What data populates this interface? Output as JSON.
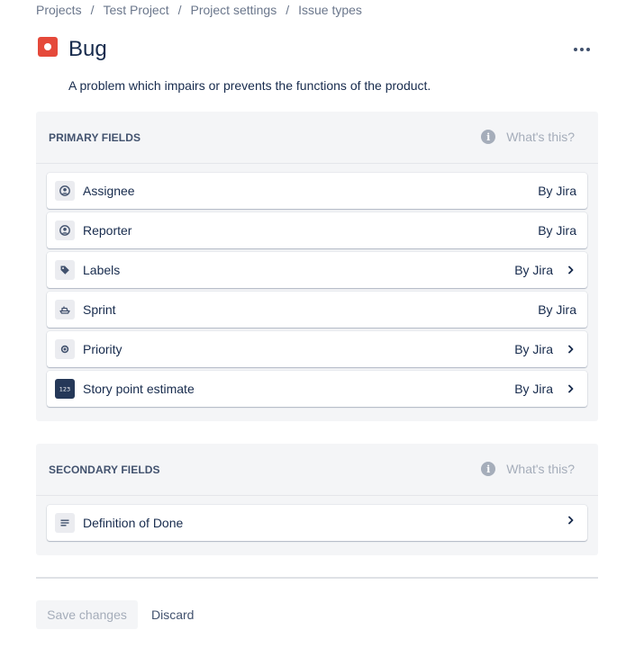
{
  "breadcrumb": {
    "items": [
      "Projects",
      "Test Project",
      "Project settings",
      "Issue types"
    ],
    "separator": "/"
  },
  "issue_type": {
    "title": "Bug",
    "icon": "bug-icon",
    "icon_color": "#e5493a",
    "description": "A problem which impairs or prevents the functions of the product."
  },
  "primary": {
    "title": "PRIMARY FIELDS",
    "help_label": "What's this?",
    "fields": [
      {
        "label": "Assignee",
        "right": "By Jira",
        "icon": "user-avatar-icon",
        "chevron": false
      },
      {
        "label": "Reporter",
        "right": "By Jira",
        "icon": "user-avatar-icon",
        "chevron": false
      },
      {
        "label": "Labels",
        "right": "By Jira",
        "icon": "tag-icon",
        "chevron": true
      },
      {
        "label": "Sprint",
        "right": "By Jira",
        "icon": "ship-icon",
        "chevron": false
      },
      {
        "label": "Priority",
        "right": "By Jira",
        "icon": "radio-dot-icon",
        "chevron": true
      },
      {
        "label": "Story point estimate",
        "right": "By Jira",
        "icon": "number-123-icon",
        "chevron": true
      }
    ]
  },
  "secondary": {
    "title": "SECONDARY FIELDS",
    "help_label": "What's this?",
    "fields": [
      {
        "label": "Definition of Done",
        "right": "",
        "icon": "paragraph-icon",
        "chevron": true
      }
    ]
  },
  "actions": {
    "save_label": "Save changes",
    "discard_label": "Discard"
  }
}
